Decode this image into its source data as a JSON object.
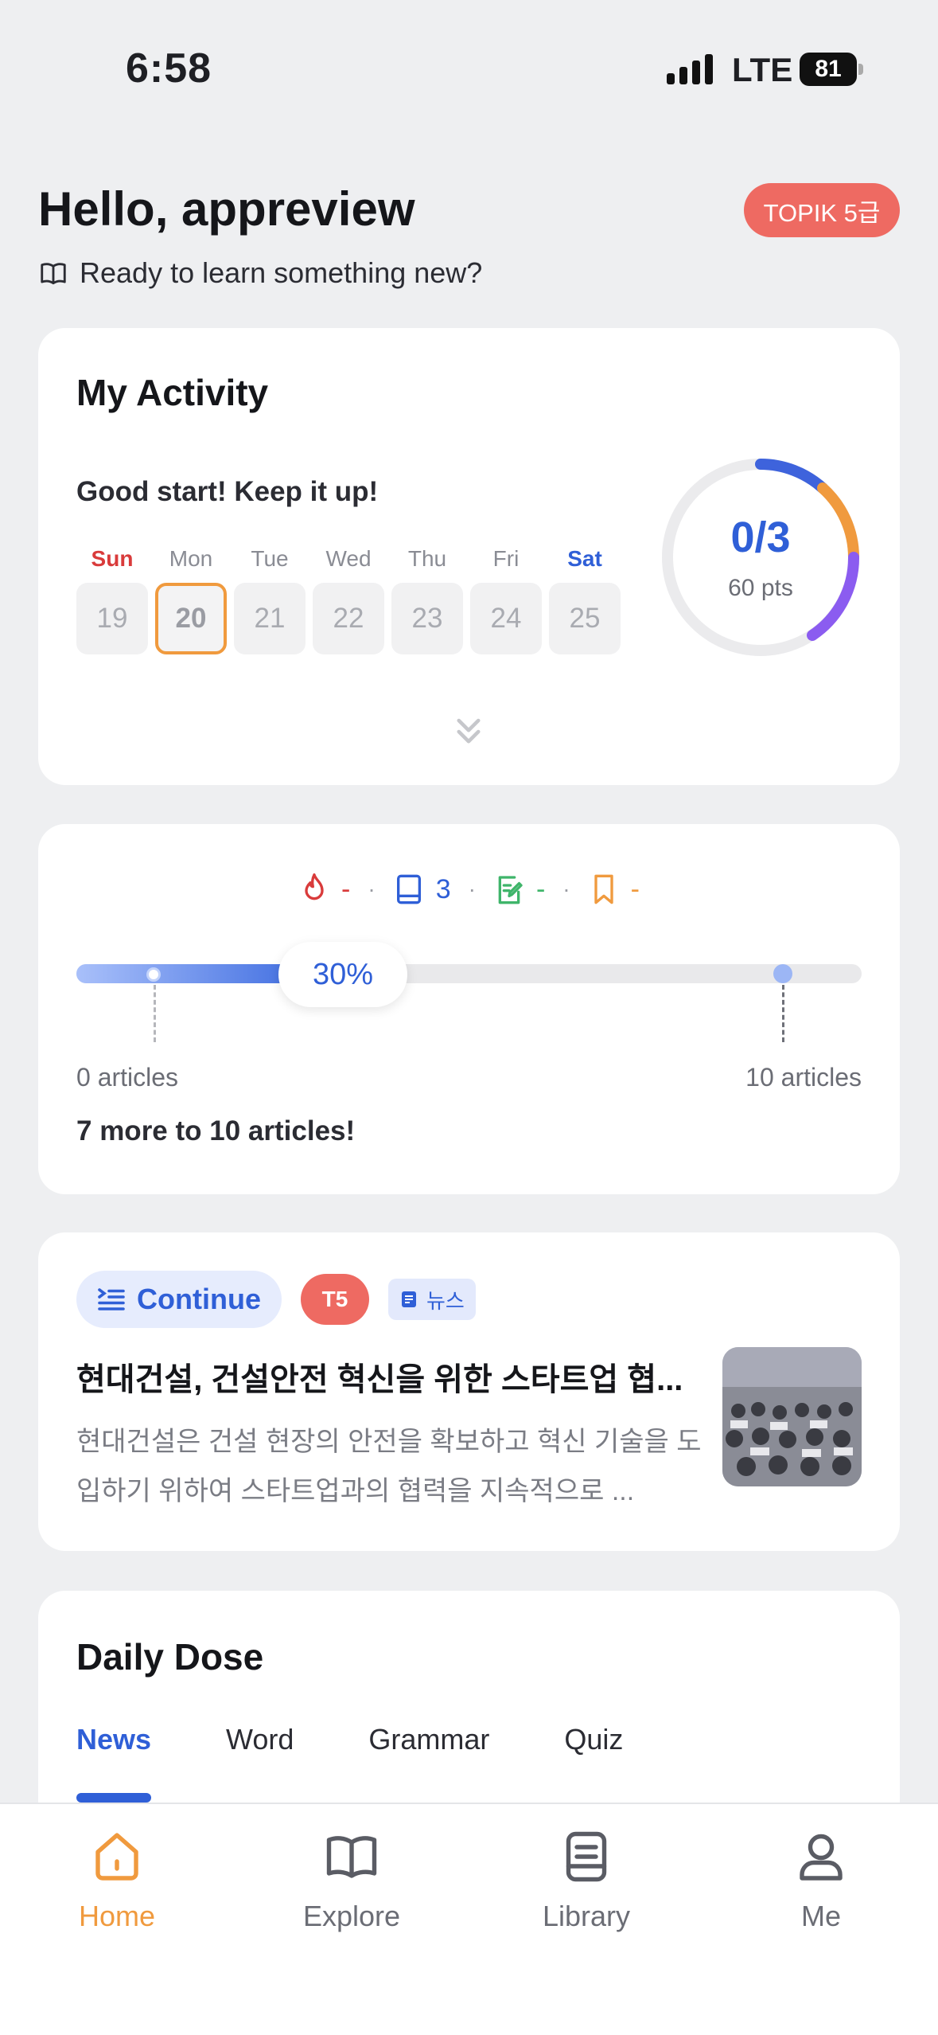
{
  "status": {
    "time": "6:58",
    "network": "LTE",
    "battery": "81"
  },
  "header": {
    "greeting": "Hello, appreview",
    "level": "TOPIK 5급",
    "subtitle": "Ready to learn something new?"
  },
  "activity": {
    "title": "My Activity",
    "message": "Good start! Keep it up!",
    "days": [
      {
        "label": "Sun",
        "num": "19"
      },
      {
        "label": "Mon",
        "num": "20"
      },
      {
        "label": "Tue",
        "num": "21"
      },
      {
        "label": "Wed",
        "num": "22"
      },
      {
        "label": "Thu",
        "num": "23"
      },
      {
        "label": "Fri",
        "num": "24"
      },
      {
        "label": "Sat",
        "num": "25"
      }
    ],
    "today_index": 1,
    "ring_value": "0/3",
    "ring_sub": "60 pts",
    "ring_colors": [
      "#3E63DC",
      "#F09A3E",
      "#8B5CF0"
    ]
  },
  "progress": {
    "stats": {
      "fire": "-",
      "read": "3",
      "quiz": "-",
      "bookmark": "-"
    },
    "percent": 30,
    "percent_label": "30%",
    "start_label": "0 articles",
    "end_label": "10 articles",
    "message": "7 more to 10 articles!"
  },
  "continue": {
    "button": "Continue",
    "level_tag": "T5",
    "category": "뉴스",
    "title": "현대건설, 건설안전 혁신을 위한 스타트업 협...",
    "summary": "현대건설은 건설 현장의 안전을 확보하고 혁신 기술을 도입하기 위하여 스타트업과의 협력을 지속적으로 ..."
  },
  "daily": {
    "title": "Daily Dose",
    "tabs": [
      "News",
      "Word",
      "Grammar",
      "Quiz"
    ],
    "active_tab": "News"
  },
  "nav": [
    {
      "label": "Home",
      "icon": "home-icon",
      "active": true
    },
    {
      "label": "Explore",
      "icon": "book-open-icon",
      "active": false
    },
    {
      "label": "Library",
      "icon": "library-icon",
      "active": false
    },
    {
      "label": "Me",
      "icon": "person-icon",
      "active": false
    }
  ],
  "colors": {
    "accent_blue": "#2F5FD7",
    "accent_orange": "#F09A3E",
    "badge_red": "#EE6A62"
  }
}
